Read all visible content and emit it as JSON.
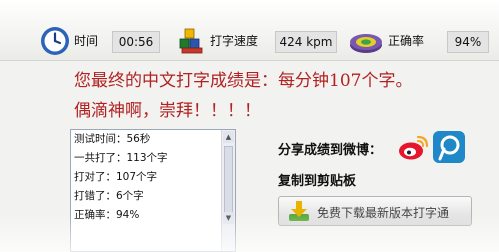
{
  "topbar": {
    "time_label": "时间",
    "time_value": "00:56",
    "speed_label": "打字速度",
    "speed_value": "424 kpm",
    "accuracy_label": "正确率",
    "accuracy_value": "94%"
  },
  "result": {
    "line1": "您最终的中文打字成绩是：每分钟107个字。",
    "line2": "偶滴神啊，崇拜！！！！"
  },
  "stats": [
    "测试时间：56秒",
    "一共打了：113个字",
    "打对了：107个字",
    "打错了：6个字",
    "正确率：94%"
  ],
  "share": {
    "share_label": "分享成绩到微博：",
    "copy_label": "复制到剪贴板",
    "download_label": "免费下载最新版本打字通"
  },
  "colors": {
    "result_text": "#b22222",
    "weibo": "#e6162d",
    "tencent": "#1e88c8"
  }
}
